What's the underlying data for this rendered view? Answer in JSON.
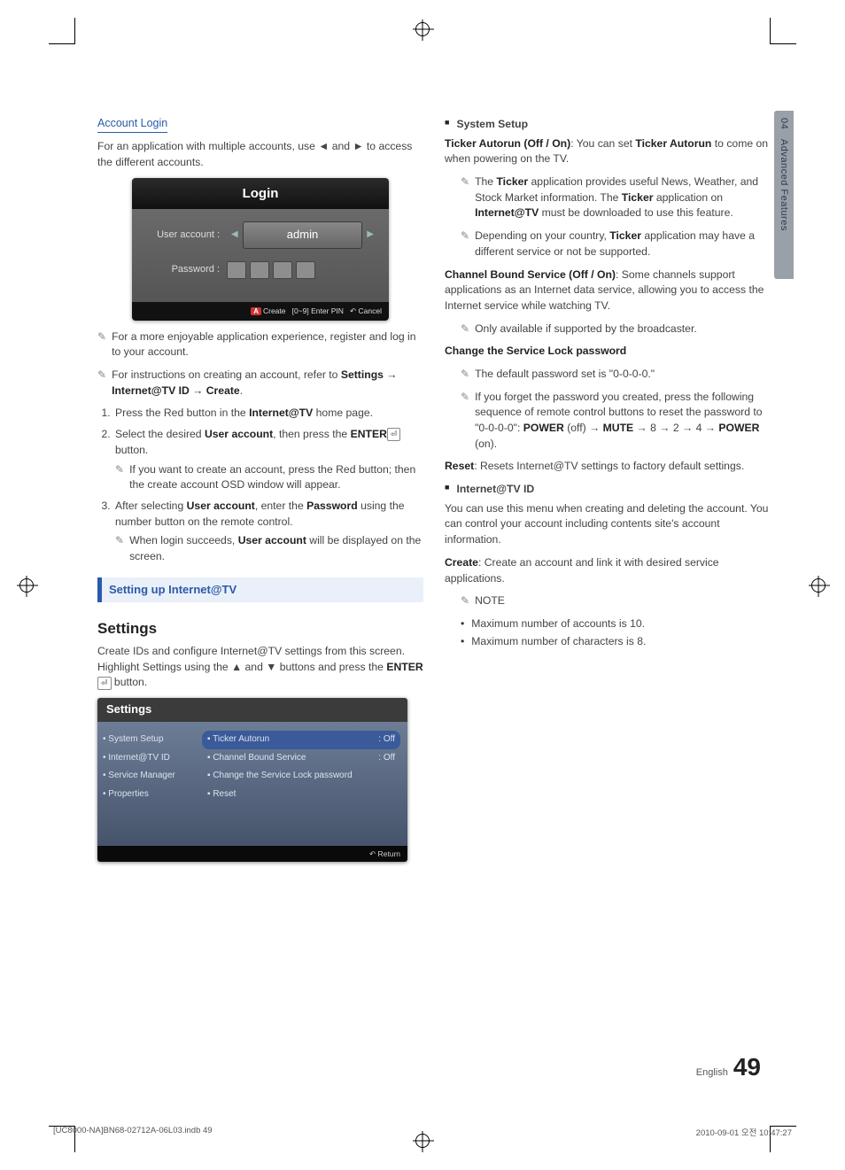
{
  "side_tab": {
    "chapter_num": "04",
    "chapter_title": "Advanced Features"
  },
  "left": {
    "account_login_head": "Account Login",
    "account_login_desc_1": "For an application with multiple accounts, use ◄ and ► to access the different accounts.",
    "login_box": {
      "title": "Login",
      "user_label": "User account :",
      "user_value": "admin",
      "pwd_label": "Password :",
      "footer_create": "Create",
      "footer_enterpin": "[0~9] Enter PIN",
      "footer_cancel": "Cancel"
    },
    "note1": "For a more enjoyable application experience, register and log in to your account.",
    "note2_a": "For instructions on creating an account, refer to ",
    "note2_b": "Settings → Internet@TV ID → Create",
    "note2_c": ".",
    "step1_a": "Press the Red button in the ",
    "step1_b": "Internet@TV",
    "step1_c": " home page.",
    "step2_a": "Select the desired ",
    "step2_b": "User account",
    "step2_c": ", then press the ",
    "step2_d": "ENTER",
    "step2_e": " button.",
    "step2_sub": "If you want to create an account, press the Red button; then the create account OSD window will appear.",
    "step3_a": "After selecting ",
    "step3_b": "User account",
    "step3_c": ", enter the ",
    "step3_d": "Password",
    "step3_e": " using the number button on the remote control.",
    "step3_sub_a": "When login succeeds, ",
    "step3_sub_b": "User account",
    "step3_sub_c": " will be displayed on the screen.",
    "blue_head": "Setting up Internet@TV",
    "settings_head": "Settings",
    "settings_desc_a": "Create IDs and configure Internet@TV settings from this screen. Highlight Settings using the ▲ and ▼ buttons and press the ",
    "settings_desc_b": "ENTER",
    "settings_desc_c": " button.",
    "settings_panel": {
      "title": "Settings",
      "left_items": [
        "• System Setup",
        "• Internet@TV ID",
        "• Service Manager",
        "• Properties"
      ],
      "right_items": [
        {
          "label": "▪ Ticker Autorun",
          "value": ": Off",
          "sel": true
        },
        {
          "label": "▪ Channel Bound Service",
          "value": ": Off",
          "sel": false
        },
        {
          "label": "▪ Change the Service Lock password",
          "value": "",
          "sel": false
        },
        {
          "label": "▪ Reset",
          "value": "",
          "sel": false
        }
      ],
      "footer_return": "Return"
    }
  },
  "right": {
    "system_setup_head": "System Setup",
    "ticker_a": "Ticker Autorun (Off / On)",
    "ticker_b": ": You can set ",
    "ticker_c": "Ticker Autorun",
    "ticker_d": " to come on when powering on the TV.",
    "note1_a": "The ",
    "note1_b": "Ticker",
    "note1_c": " application provides useful News, Weather, and Stock Market information. The ",
    "note1_d": "Ticker",
    "note1_e": " application on ",
    "note1_f": "Internet@TV",
    "note1_g": " must be downloaded to use this feature.",
    "note2_a": "Depending on your country, ",
    "note2_b": "Ticker",
    "note2_c": " application may have a different service or not be supported.",
    "cbs_a": "Channel Bound Service (Off / On)",
    "cbs_b": ": Some channels support applications as an Internet data service, allowing you to access the Internet service while watching TV.",
    "cbs_note": "Only available if supported by the broadcaster.",
    "change_pwd_head": "Change the Service Lock password",
    "cp_note1": "The default password set is \"0-0-0-0.\"",
    "cp_note2_a": "If you forget the password you created, press the following sequence of remote control buttons to reset the password to \"0-0-0-0\": ",
    "cp_note2_b": "POWER",
    "cp_note2_c": " (off) → ",
    "cp_note2_d": "MUTE",
    "cp_note2_e": " → 8 → 2 → 4 → ",
    "cp_note2_f": "POWER",
    "cp_note2_g": " (on).",
    "reset_a": "Reset",
    "reset_b": ": Resets Internet@TV settings to factory default settings.",
    "id_head": "Internet@TV ID",
    "id_desc": "You can use this menu when creating and deleting the account. You can control your account including contents site's account information.",
    "create_a": "Create",
    "create_b": ": Create an account and link it with desired service applications.",
    "note_head": "NOTE",
    "bul1": "Maximum number of accounts is 10.",
    "bul2": "Maximum number of characters is 8."
  },
  "page_footer": {
    "lang": "English",
    "page_num": "49",
    "file_meta": "[UC8000-NA]BN68-02712A-06L03.indb   49",
    "date_meta": "2010-09-01   오전 10:47:27"
  }
}
